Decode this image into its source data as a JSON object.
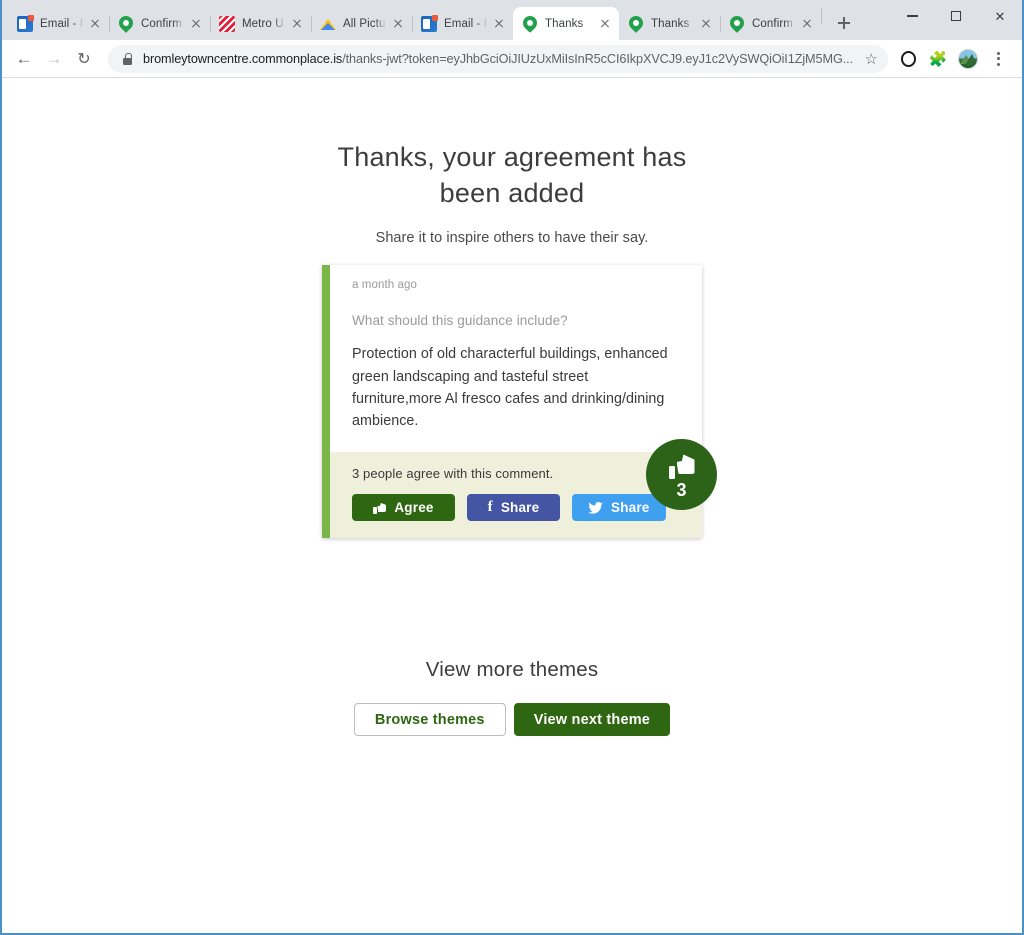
{
  "browser": {
    "tabs": [
      {
        "title": "Email - I",
        "favicon": "outlook-icon",
        "active": false,
        "separator": false
      },
      {
        "title": "Confirm",
        "favicon": "commonplace-pin-icon",
        "active": false,
        "separator": true
      },
      {
        "title": "Metro U",
        "favicon": "metro-icon",
        "active": false,
        "separator": true
      },
      {
        "title": "All Pictu",
        "favicon": "google-drive-icon",
        "active": false,
        "separator": true
      },
      {
        "title": "Email - I",
        "favicon": "outlook-icon",
        "active": false,
        "separator": true
      },
      {
        "title": "Thanks",
        "favicon": "commonplace-pin-icon",
        "active": true,
        "separator": false
      },
      {
        "title": "Thanks",
        "favicon": "commonplace-pin-icon",
        "active": false,
        "separator": false
      },
      {
        "title": "Confirm",
        "favicon": "commonplace-pin-icon",
        "active": false,
        "separator": true
      }
    ],
    "new_tab_label": "+",
    "window_controls": {
      "minimize": "minimize-icon",
      "maximize": "maximize-icon",
      "close": "close-icon"
    },
    "nav": {
      "back": "back-arrow-icon",
      "forward": "forward-arrow-icon",
      "reload": "reload-icon"
    },
    "omnibox": {
      "lock": "lock-icon",
      "url_host": "bromleytowncentre.commonplace.is",
      "url_path": "/thanks-jwt?token=eyJhbGciOiJIUzUxMiIsInR5cCI6IkpXVCJ9.eyJ1c2VySWQiOiI1ZjM5MG...",
      "bookmark": "star-icon"
    },
    "toolbar_right": {
      "opera": "opera-icon",
      "extensions": "puzzle-piece-icon",
      "profile": "profile-avatar-icon",
      "menu": "three-dot-menu-icon"
    }
  },
  "page": {
    "heading": "Thanks, your agreement has been added",
    "subheading": "Share it to inspire others to have their say.",
    "comment_card": {
      "timestamp": "a month ago",
      "question": "What should this guidance include?",
      "body": "Protection of old characterful buildings, enhanced green landscaping and tasteful street furniture,more Al fresco cafes and drinking/dining ambience.",
      "agree_count_text": "3 people agree with this comment.",
      "agree_button": "Agree",
      "facebook_share_button": "Share",
      "twitter_share_button": "Share",
      "badge_count": "3",
      "accent_stripe_color": "#7ab648",
      "footer_bg_color": "#eef0dc",
      "agree_color": "#2e6612",
      "facebook_color": "#4456a3",
      "twitter_color": "#3fa0f0",
      "badge_color": "#2c6318"
    },
    "more": {
      "title": "View more themes",
      "browse_button": "Browse themes",
      "next_button": "View next theme"
    }
  }
}
